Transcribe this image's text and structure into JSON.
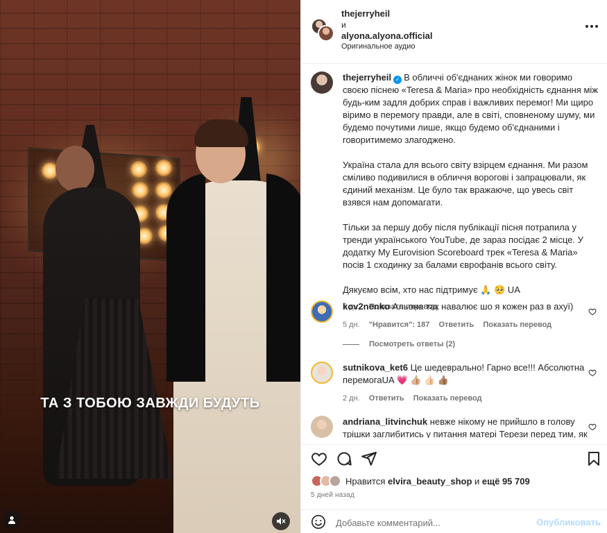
{
  "media": {
    "caption_overlay": "ТА З ТОБОЮ ЗАВЖДИ БУДУТЬ",
    "mute_icon": "speaker-muted-icon",
    "user_tag_icon": "person-icon"
  },
  "header": {
    "author1": "thejerryheil",
    "and": "и",
    "author2": "alyona.alyona.official",
    "audio": "Оригинальное аудио",
    "more_icon": "more-horizontal-icon"
  },
  "post": {
    "username": "thejerryheil",
    "paragraphs": [
      "В обличчі об'єднаних жінок ми говоримо своєю піснею «Teresa & Maria» про необхідність єднання між будь-ким задля добрих справ і важливих перемог! Ми щиро віримо в перемогу правди, але в світі, сповненому шуму, ми будемо почутими лише, якщо будемо об'єднаними і говоритимемо злагоджено.",
      "Україна стала для всього світу взірцем єднання. Ми разом сміливо подивилися в обличчя ворогові і запрацювали, як єдиний механізм. Це було так вражаюче, що увесь світ взявся нам допомагати.",
      "Тільки за першу добу після публікації пісня потрапила у тренди українського YouTube, де зараз посідає 2 місце. У додатку My Eurovision Scoreboard трек «Teresa & Maria» посів 1 сходинку за балами єврофанів всього світу.",
      "Дякуємо всім, хто нас підтримує 🙏 🥺 UA"
    ],
    "age": "5 дн.",
    "translate": "Показать перевод"
  },
  "comments": [
    {
      "username": "kov2nenko",
      "text": "Альона так навалює шо я кожен раз в ахуї)",
      "age": "5 дн.",
      "likes": "\"Нравится\": 187",
      "reply": "Ответить",
      "translate": "Показать перевод",
      "view_replies": "Посмотреть ответы (2)"
    },
    {
      "username": "sutnikova_ket6",
      "text": "Це шедеврально! Гарно все!!! Абсолютна перемогаUA 💗 👍🏼 👍🏻 👍🏽",
      "age": "2 дн.",
      "reply": "Ответить",
      "translate": "Показать перевод"
    },
    {
      "username": "andriana_litvinchuk",
      "text": "невже нікому не прийшло в голову трішки заглибитись у питання матері Терези перед тим, як"
    }
  ],
  "actions": {
    "like_icon": "heart-icon",
    "comment_icon": "comment-icon",
    "share_icon": "send-icon",
    "save_icon": "bookmark-icon"
  },
  "likes": {
    "prefix": "Нравится",
    "user": "elvira_beauty_shop",
    "and": "и",
    "others": "ещё 95 709"
  },
  "timestamp": "5 дней назад",
  "add_comment": {
    "placeholder": "Добавьте комментарий...",
    "publish": "Опубликовать",
    "emoji_icon": "smiley-icon"
  },
  "colors": {
    "link_blue": "#0095f6",
    "publish_disabled": "#b3dbff",
    "secondary_text": "#737373"
  }
}
